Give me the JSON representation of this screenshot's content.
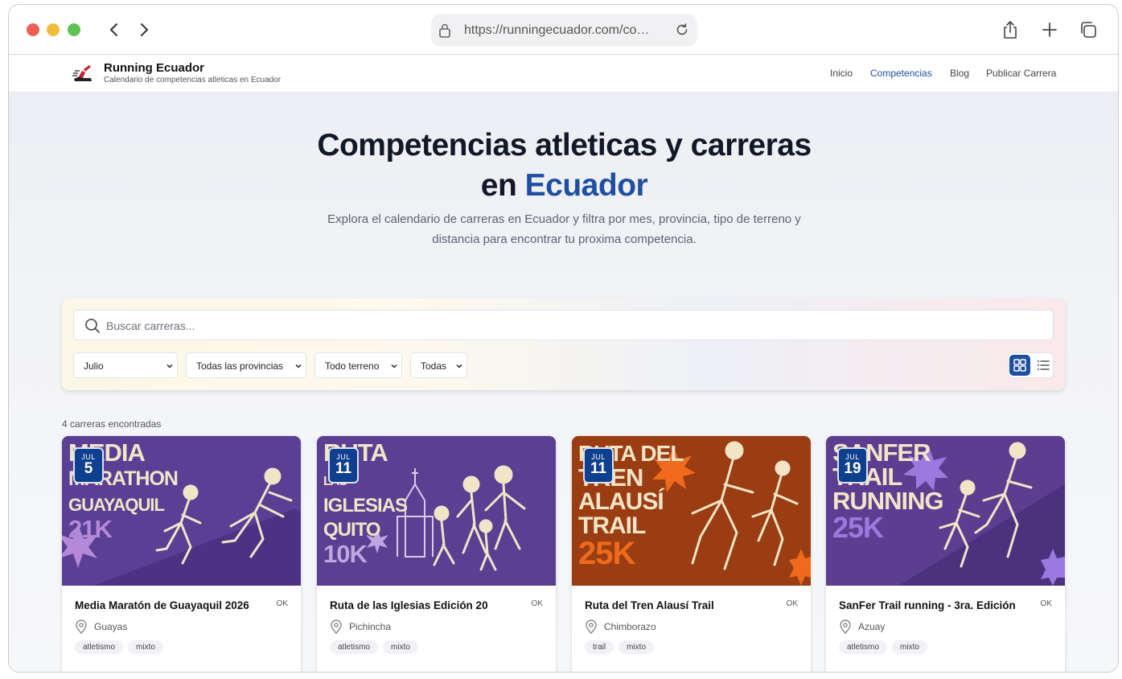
{
  "browser": {
    "url": "https://runningecuador.com/co…"
  },
  "site": {
    "title": "Running Ecuador",
    "subtitle": "Calendario de competencias atleticas en Ecuador",
    "nav": [
      {
        "label": "Inicio",
        "active": false
      },
      {
        "label": "Competencias",
        "active": true
      },
      {
        "label": "Blog",
        "active": false
      },
      {
        "label": "Publicar Carrera",
        "active": false
      }
    ]
  },
  "hero": {
    "title_line1": "Competencias atleticas y carreras",
    "title_line2_prefix": "en ",
    "title_line2_accent": "Ecuador",
    "description_line1": "Explora el calendario de carreras en Ecuador y filtra por mes, provincia, tipo de terreno y",
    "description_line2": "distancia para encontrar tu proxima competencia."
  },
  "filters": {
    "search_placeholder": "Buscar carreras...",
    "month": "Julio",
    "province": "Todas las provincias",
    "terrain": "Todo terreno",
    "distance": "Todas"
  },
  "results_count": "4 carreras encontradas",
  "cards": [
    {
      "month": "JUL",
      "day": "5",
      "poster_line1": "MEDIA",
      "poster_line2": "MARATHON",
      "poster_line3": "GUAYAQUIL",
      "poster_dist": "21K",
      "title": "Media Maratón de Guayaquil 2026",
      "status": "OK",
      "province": "Guayas",
      "tags": [
        "atletismo",
        "mixto"
      ],
      "bg": "#5b3f95",
      "poster_color": "#f1e5c8",
      "accent": "#b48ad8"
    },
    {
      "month": "JUL",
      "day": "11",
      "poster_line1": "RUTA",
      "poster_line2": "LAS",
      "poster_line3": "IGLESIAS QUITO",
      "poster_dist": "10K",
      "title": "Ruta de las Iglesias Edición 20",
      "status": "OK",
      "province": "Pichincha",
      "tags": [
        "atletismo",
        "mixto"
      ],
      "bg": "#5a3f93",
      "poster_color": "#f1e5c8",
      "accent": "#c0a6e0"
    },
    {
      "month": "JUL",
      "day": "11",
      "poster_line1": "RUTA DEL",
      "poster_line2": "TREN",
      "poster_line3": "ALAUSÍ TRAIL",
      "poster_dist": "25K",
      "title": "Ruta del Tren Alausí Trail",
      "status": "OK",
      "province": "Chimborazo",
      "tags": [
        "trail",
        "mixto"
      ],
      "bg": "#9a3d12",
      "poster_color": "#f3e4c6",
      "accent": "#ef6a1c"
    },
    {
      "month": "JUL",
      "day": "19",
      "poster_line1": "SANFER",
      "poster_line2": "TRAIL",
      "poster_line3": "RUNNING",
      "poster_dist": "25K",
      "title": "SanFer Trail running - 3ra. Edición",
      "status": "OK",
      "province": "Azuay",
      "tags": [
        "atletismo",
        "mixto"
      ],
      "bg": "#5b3e8f",
      "poster_color": "#f1e5c8",
      "accent": "#9b7ae0"
    }
  ],
  "colors": {
    "primary": "#1f4fa3",
    "badge": "#0f3f8f"
  }
}
